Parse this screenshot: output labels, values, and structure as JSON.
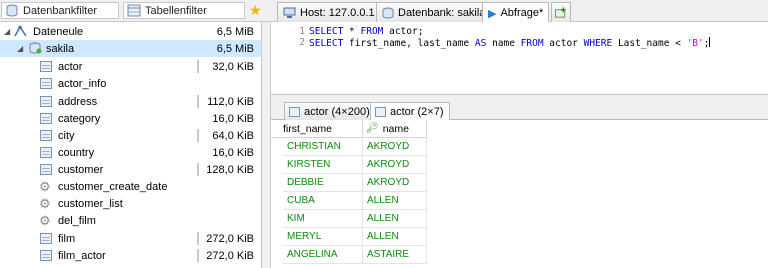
{
  "top": {
    "filter_db": "Datenbankfilter",
    "filter_table": "Tabellenfilter",
    "tabs": [
      {
        "label": "Host: 127.0.0.1"
      },
      {
        "label": "Datenbank: sakila"
      },
      {
        "label": "Abfrage*"
      }
    ]
  },
  "tree": {
    "root": {
      "label": "Dateneule",
      "size": "6,5 MiB"
    },
    "db": {
      "label": "sakila",
      "size": "6,5 MiB"
    },
    "items": [
      {
        "label": "actor",
        "size": "32,0 KiB",
        "icon": "table-icon"
      },
      {
        "label": "actor_info",
        "size": "",
        "icon": "table-icon"
      },
      {
        "label": "address",
        "size": "112,0 KiB",
        "icon": "table-icon"
      },
      {
        "label": "category",
        "size": "16,0 KiB",
        "icon": "table-icon"
      },
      {
        "label": "city",
        "size": "64,0 KiB",
        "icon": "table-icon"
      },
      {
        "label": "country",
        "size": "16,0 KiB",
        "icon": "table-icon"
      },
      {
        "label": "customer",
        "size": "128,0 KiB",
        "icon": "table-icon"
      },
      {
        "label": "customer_create_date",
        "size": "",
        "icon": "gear-icon"
      },
      {
        "label": "customer_list",
        "size": "",
        "icon": "gear-icon"
      },
      {
        "label": "del_film",
        "size": "",
        "icon": "gear-icon"
      },
      {
        "label": "film",
        "size": "272,0 KiB",
        "icon": "table-icon"
      },
      {
        "label": "film_actor",
        "size": "272,0 KiB",
        "icon": "table-icon"
      }
    ]
  },
  "editor": {
    "lines": [
      "1",
      "2"
    ],
    "line1": {
      "kw1": "SELECT",
      "rest": " * ",
      "kw2": "FROM",
      "rest2": " actor;"
    },
    "line2": {
      "kw1": "SELECT",
      "p1": " first_name, last_name ",
      "kw2": "AS",
      "p2": " name ",
      "kw3": "FROM",
      "p3": " actor ",
      "kw4": "WHERE",
      "p4": " Last_name < ",
      "str": "'B'",
      "p5": ";"
    }
  },
  "results": {
    "tabs": [
      {
        "label": "actor (4×200)"
      },
      {
        "label": "actor (2×7)"
      }
    ],
    "columns": [
      "first_name",
      "name"
    ],
    "rows": [
      [
        "CHRISTIAN",
        "AKROYD"
      ],
      [
        "KIRSTEN",
        "AKROYD"
      ],
      [
        "DEBBIE",
        "AKROYD"
      ],
      [
        "CUBA",
        "ALLEN"
      ],
      [
        "KIM",
        "ALLEN"
      ],
      [
        "MERYL",
        "ALLEN"
      ],
      [
        "ANGELINA",
        "ASTAIRE"
      ]
    ]
  }
}
